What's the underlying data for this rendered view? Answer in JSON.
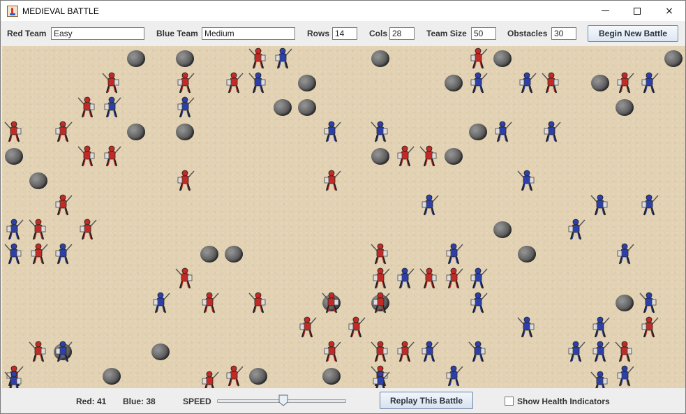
{
  "window": {
    "title": "MEDIEVAL BATTLE",
    "minimize_glyph": "minimize-icon",
    "maximize_glyph": "maximize-icon",
    "close_glyph": "×"
  },
  "toolbar": {
    "red_team_label": "Red Team",
    "red_team_value": "Easy",
    "blue_team_label": "Blue Team",
    "blue_team_value": "Medium",
    "rows_label": "Rows",
    "rows_value": "14",
    "cols_label": "Cols",
    "cols_value": "28",
    "team_size_label": "Team Size",
    "team_size_value": "50",
    "obstacles_label": "Obstacles",
    "obstacles_value": "30",
    "begin_button": "Begin New Battle"
  },
  "status": {
    "red_count": "Red: 41",
    "blue_count": "Blue: 38",
    "speed_label": "SPEED",
    "speed_level": 0.5,
    "replay_button": "Replay This Battle",
    "health_checkbox_checked": false,
    "health_checkbox_label": "Show Health Indicators"
  },
  "battlefield": {
    "grid_rows": 14,
    "grid_cols": 28,
    "colors": {
      "red": "#c22b25",
      "blue": "#2d3fa8",
      "sand": "#e2d2b3",
      "rock": "#5a5a5a"
    },
    "rocks": [
      [
        0,
        5
      ],
      [
        0,
        7
      ],
      [
        0,
        15
      ],
      [
        0,
        20
      ],
      [
        0,
        27
      ],
      [
        1,
        12
      ],
      [
        1,
        18
      ],
      [
        1,
        24
      ],
      [
        2,
        11
      ],
      [
        2,
        12
      ],
      [
        2,
        25
      ],
      [
        3,
        5
      ],
      [
        3,
        7
      ],
      [
        3,
        19
      ],
      [
        4,
        0
      ],
      [
        4,
        15
      ],
      [
        4,
        18
      ],
      [
        5,
        1
      ],
      [
        7,
        20
      ],
      [
        8,
        8
      ],
      [
        8,
        9
      ],
      [
        8,
        21
      ],
      [
        10,
        13
      ],
      [
        10,
        15
      ],
      [
        10,
        25
      ],
      [
        12,
        2
      ],
      [
        12,
        6
      ],
      [
        13,
        4
      ],
      [
        13,
        10
      ],
      [
        13,
        13
      ]
    ],
    "units": [
      {
        "team": "red",
        "r": 0,
        "c": 10
      },
      {
        "team": "blue",
        "r": 0,
        "c": 11
      },
      {
        "team": "red",
        "r": 0,
        "c": 19
      },
      {
        "team": "red",
        "r": 1,
        "c": 4
      },
      {
        "team": "red",
        "r": 1,
        "c": 7
      },
      {
        "team": "red",
        "r": 1,
        "c": 9
      },
      {
        "team": "blue",
        "r": 1,
        "c": 10
      },
      {
        "team": "blue",
        "r": 1,
        "c": 19
      },
      {
        "team": "blue",
        "r": 1,
        "c": 21
      },
      {
        "team": "red",
        "r": 1,
        "c": 22
      },
      {
        "team": "red",
        "r": 1,
        "c": 25
      },
      {
        "team": "blue",
        "r": 1,
        "c": 26
      },
      {
        "team": "red",
        "r": 2,
        "c": 3
      },
      {
        "team": "blue",
        "r": 2,
        "c": 4
      },
      {
        "team": "blue",
        "r": 2,
        "c": 7
      },
      {
        "team": "red",
        "r": 3,
        "c": 0
      },
      {
        "team": "red",
        "r": 3,
        "c": 2
      },
      {
        "team": "blue",
        "r": 3,
        "c": 13
      },
      {
        "team": "blue",
        "r": 3,
        "c": 15
      },
      {
        "team": "blue",
        "r": 3,
        "c": 20
      },
      {
        "team": "blue",
        "r": 3,
        "c": 22
      },
      {
        "team": "red",
        "r": 4,
        "c": 3
      },
      {
        "team": "red",
        "r": 4,
        "c": 4
      },
      {
        "team": "red",
        "r": 4,
        "c": 16
      },
      {
        "team": "red",
        "r": 4,
        "c": 17
      },
      {
        "team": "red",
        "r": 5,
        "c": 7
      },
      {
        "team": "red",
        "r": 5,
        "c": 13
      },
      {
        "team": "blue",
        "r": 5,
        "c": 21
      },
      {
        "team": "red",
        "r": 6,
        "c": 2
      },
      {
        "team": "blue",
        "r": 6,
        "c": 17
      },
      {
        "team": "blue",
        "r": 6,
        "c": 24
      },
      {
        "team": "blue",
        "r": 6,
        "c": 26
      },
      {
        "team": "blue",
        "r": 7,
        "c": 0
      },
      {
        "team": "red",
        "r": 7,
        "c": 1
      },
      {
        "team": "red",
        "r": 7,
        "c": 3
      },
      {
        "team": "blue",
        "r": 7,
        "c": 23
      },
      {
        "team": "blue",
        "r": 8,
        "c": 0
      },
      {
        "team": "red",
        "r": 8,
        "c": 1
      },
      {
        "team": "blue",
        "r": 8,
        "c": 2
      },
      {
        "team": "red",
        "r": 8,
        "c": 15
      },
      {
        "team": "blue",
        "r": 8,
        "c": 18
      },
      {
        "team": "blue",
        "r": 8,
        "c": 25
      },
      {
        "team": "red",
        "r": 9,
        "c": 7
      },
      {
        "team": "red",
        "r": 9,
        "c": 15
      },
      {
        "team": "blue",
        "r": 9,
        "c": 16
      },
      {
        "team": "red",
        "r": 9,
        "c": 17
      },
      {
        "team": "red",
        "r": 9,
        "c": 18
      },
      {
        "team": "blue",
        "r": 9,
        "c": 19
      },
      {
        "team": "red",
        "r": 10,
        "c": 13
      },
      {
        "team": "blue",
        "r": 10,
        "c": 6
      },
      {
        "team": "red",
        "r": 10,
        "c": 8
      },
      {
        "team": "red",
        "r": 10,
        "c": 10
      },
      {
        "team": "red",
        "r": 10,
        "c": 15
      },
      {
        "team": "blue",
        "r": 10,
        "c": 19
      },
      {
        "team": "blue",
        "r": 10,
        "c": 26
      },
      {
        "team": "red",
        "r": 11,
        "c": 14
      },
      {
        "team": "red",
        "r": 11,
        "c": 12
      },
      {
        "team": "blue",
        "r": 11,
        "c": 21
      },
      {
        "team": "blue",
        "r": 11,
        "c": 24
      },
      {
        "team": "red",
        "r": 11,
        "c": 26
      },
      {
        "team": "red",
        "r": 12,
        "c": 1
      },
      {
        "team": "blue",
        "r": 12,
        "c": 2
      },
      {
        "team": "red",
        "r": 12,
        "c": 13
      },
      {
        "team": "red",
        "r": 12,
        "c": 15
      },
      {
        "team": "red",
        "r": 12,
        "c": 16
      },
      {
        "team": "blue",
        "r": 12,
        "c": 17
      },
      {
        "team": "blue",
        "r": 12,
        "c": 19
      },
      {
        "team": "blue",
        "r": 12,
        "c": 23
      },
      {
        "team": "blue",
        "r": 12,
        "c": 24
      },
      {
        "team": "red",
        "r": 12,
        "c": 25
      },
      {
        "team": "red",
        "r": 13,
        "c": 0
      },
      {
        "team": "red",
        "r": 13,
        "c": 9
      },
      {
        "team": "red",
        "r": 13,
        "c": 15
      },
      {
        "team": "blue",
        "r": 13,
        "c": 18
      },
      {
        "team": "blue",
        "r": 13,
        "c": 25
      },
      {
        "team": "blue",
        "r": 14,
        "c": 0
      },
      {
        "team": "red",
        "r": 14,
        "c": 8
      },
      {
        "team": "blue",
        "r": 14,
        "c": 15
      },
      {
        "team": "blue",
        "r": 14,
        "c": 24
      }
    ]
  }
}
